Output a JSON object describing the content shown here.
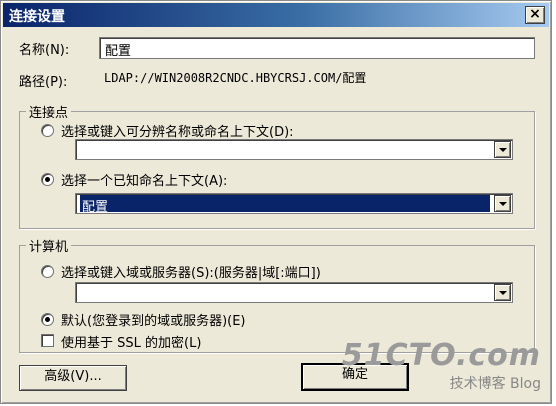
{
  "window": {
    "title": "连接设置",
    "close_glyph": "×"
  },
  "name_field": {
    "label": "名称(N):",
    "value": "配置"
  },
  "path_field": {
    "label": "路径(P):",
    "value": "LDAP://WIN2008R2CNDC.HBYCRSJ.COM/配置"
  },
  "connection_point": {
    "title": "连接点",
    "option1_label": "选择或键入可分辨名称或命名上下文(D):",
    "option1_checked": false,
    "combo1_value": "",
    "option2_label": "选择一个已知命名上下文(A):",
    "option2_checked": true,
    "combo2_value": "配置"
  },
  "computer": {
    "title": "计算机",
    "option1_label": "选择或键入域或服务器(S):(服务器|域[:端口])",
    "option1_checked": false,
    "combo_value": "",
    "option2_label": "默认(您登录到的域或服务器)(E)",
    "option2_checked": true,
    "ssl_label": "使用基于 SSL 的加密(L)",
    "ssl_checked": false
  },
  "buttons": {
    "advanced": "高级(V)...",
    "ok": "确定"
  },
  "watermark": {
    "line1": "51CTO.com",
    "line2": "技术博客  Blog"
  },
  "colors": {
    "face": "#ece9d8",
    "titlebar": "#0a246a",
    "selection": "#0a246a"
  }
}
